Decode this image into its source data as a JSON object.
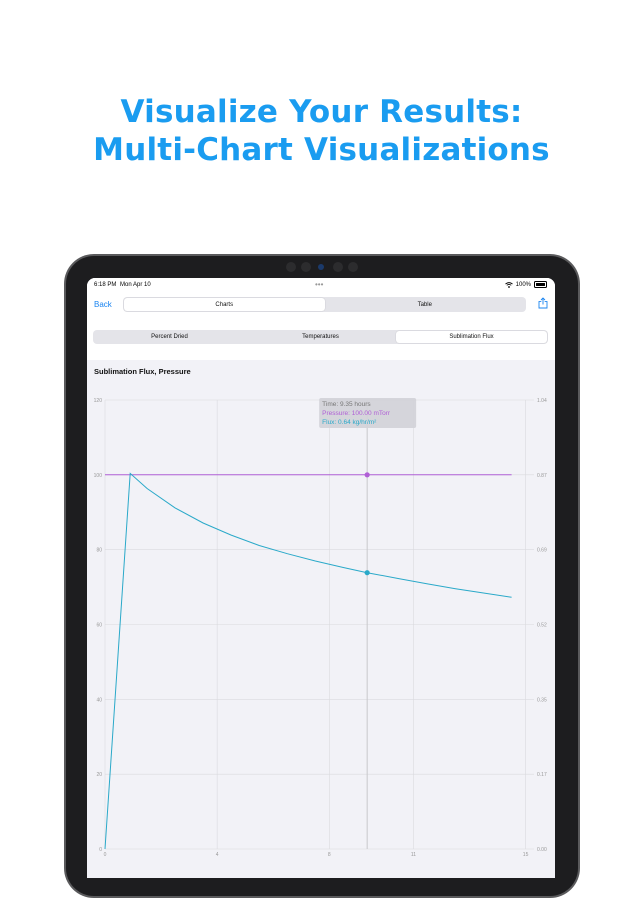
{
  "headline": {
    "line1": "Visualize Your Results:",
    "line2": "Multi-Chart Visualizations",
    "color": "#1a9cf0"
  },
  "status": {
    "time": "6:18 PM",
    "date": "Mon Apr 10",
    "battery": "100%"
  },
  "nav": {
    "back_label": "Back",
    "tabs": [
      {
        "label": "Charts",
        "active": true
      },
      {
        "label": "Table",
        "active": false
      }
    ],
    "share_icon": "share-icon"
  },
  "subtabs": [
    {
      "label": "Percent Dried",
      "active": false
    },
    {
      "label": "Temperatures",
      "active": false
    },
    {
      "label": "Sublimation Flux",
      "active": true
    }
  ],
  "chart_title": "Sublimation Flux, Pressure",
  "tooltip": {
    "time": "Time: 9.35 hours",
    "pressure": "Pressure: 100.00 mTorr",
    "flux": "Flux: 0.64 kg/hr/m²"
  },
  "chart_data": {
    "type": "line",
    "title": "Sublimation Flux, Pressure",
    "x_ticks": [
      "0",
      "4",
      "8",
      "11",
      "15"
    ],
    "xlim": [
      0,
      15.3
    ],
    "y_left_ticks": [
      "0",
      "20",
      "40",
      "60",
      "80",
      "100",
      "120"
    ],
    "y_left_lim": [
      0,
      120
    ],
    "y_right_ticks": [
      "0.00",
      "0.17",
      "0.35",
      "0.52",
      "0.69",
      "0.87",
      "1.04"
    ],
    "y_right_lim": [
      0,
      1.04
    ],
    "grid": true,
    "series": [
      {
        "axis": "left",
        "color": "#b05fd6",
        "x": [
          0,
          14.5
        ],
        "values": [
          100,
          100
        ]
      },
      {
        "axis": "right",
        "color": "#2aa9c9",
        "x": [
          0,
          0.9,
          1.5,
          2.5,
          3.5,
          4.5,
          5.5,
          6.5,
          7.5,
          8.5,
          9.35,
          10.5,
          11.5,
          12.5,
          13.5,
          14.5
        ],
        "values": [
          0,
          0.87,
          0.835,
          0.79,
          0.755,
          0.727,
          0.703,
          0.684,
          0.667,
          0.652,
          0.64,
          0.626,
          0.614,
          0.603,
          0.593,
          0.583
        ]
      }
    ],
    "cursor_x": 9.35,
    "markers": [
      {
        "series": 0,
        "x": 9.35,
        "y": 100
      },
      {
        "series": 1,
        "x": 9.35,
        "y": 0.64
      }
    ]
  }
}
